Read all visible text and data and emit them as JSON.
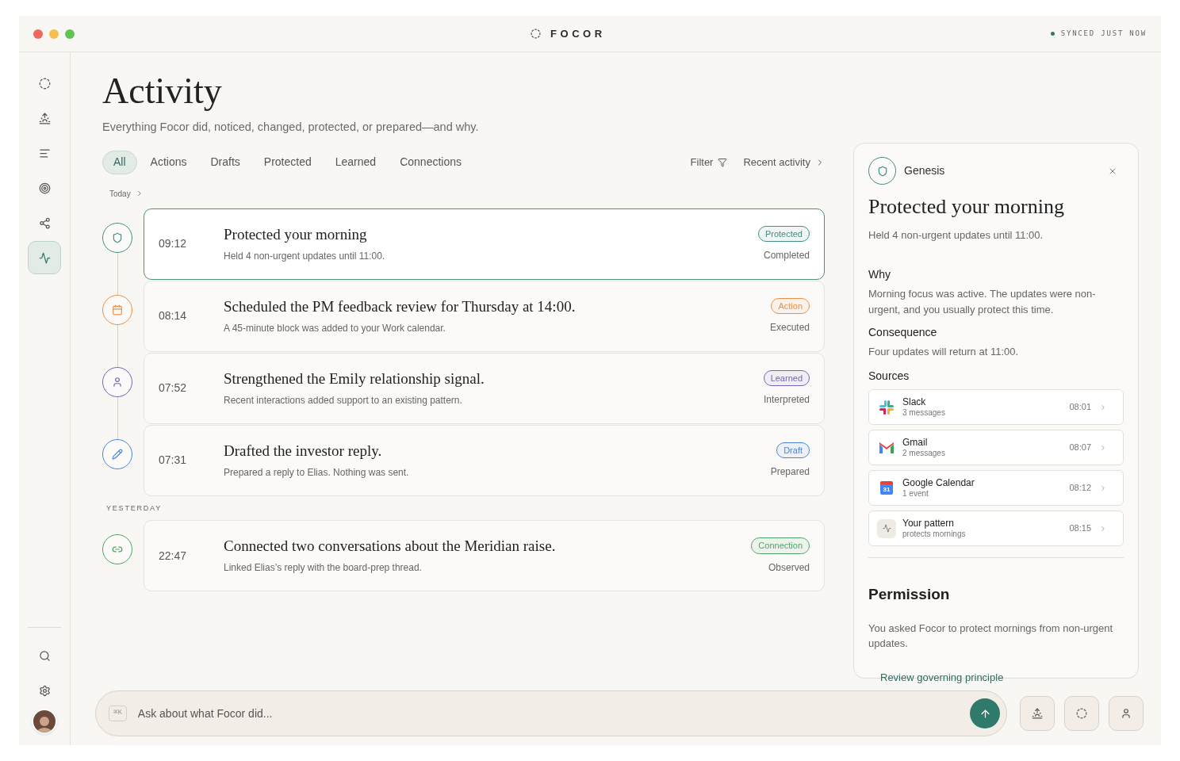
{
  "window": {
    "title": "FOCOR",
    "sync_status": "SYNCED JUST NOW"
  },
  "sidebar": {
    "items": [
      {
        "kind": "logo",
        "selected": false
      },
      {
        "kind": "sunrise",
        "selected": false
      },
      {
        "kind": "list",
        "selected": false
      },
      {
        "kind": "target",
        "selected": false
      },
      {
        "kind": "share",
        "selected": false
      },
      {
        "kind": "activity",
        "selected": true
      }
    ],
    "bottom_items": [
      {
        "kind": "search"
      },
      {
        "kind": "settings"
      }
    ]
  },
  "page": {
    "title": "Activity",
    "subtitle": "Everything Focor did, noticed, changed, protected, or prepared—and why."
  },
  "tabs": [
    {
      "label": "All",
      "selected": true
    },
    {
      "label": "Actions",
      "selected": false
    },
    {
      "label": "Drafts",
      "selected": false
    },
    {
      "label": "Protected",
      "selected": false
    },
    {
      "label": "Learned",
      "selected": false
    },
    {
      "label": "Connections",
      "selected": false
    }
  ],
  "filter": {
    "label": "Filter"
  },
  "sort": {
    "label": "Recent activity"
  },
  "groups": [
    {
      "label": "Today",
      "kind": "link",
      "items": [
        {
          "kind": "protected",
          "color": "#3f8f80",
          "time": "09:12",
          "title": "Protected your morning",
          "description": "Held 4 non-urgent updates until 11:00.",
          "tag": "Protected",
          "status": "Completed",
          "selected": true
        },
        {
          "kind": "action",
          "color": "#e8914a",
          "time": "08:14",
          "title": "Scheduled the PM feedback review for Thursday at 14:00.",
          "description": "A 45-minute block was added to your Work calendar.",
          "tag": "Action",
          "status": "Executed",
          "selected": false
        },
        {
          "kind": "learned",
          "color": "#7a62b8",
          "time": "07:52",
          "title": "Strengthened the Emily relationship signal.",
          "description": "Recent interactions added support to an existing pattern.",
          "tag": "Learned",
          "status": "Interpreted",
          "selected": false
        },
        {
          "kind": "draft",
          "color": "#4a86d9",
          "time": "07:31",
          "title": "Drafted the investor reply.",
          "description": "Prepared a reply to Elias. Nothing was sent.",
          "tag": "Draft",
          "status": "Prepared",
          "selected": false
        }
      ]
    },
    {
      "label": "YESTERDAY",
      "kind": "caps",
      "items": [
        {
          "kind": "connection",
          "color": "#4fa36a",
          "time": "22:47",
          "title": "Connected two conversations about the Meridian raise.",
          "description": "Linked Elias’s reply with the board-prep thread.",
          "tag": "Connection",
          "status": "Observed",
          "selected": false
        }
      ]
    }
  ],
  "detail": {
    "source": "Genesis",
    "title": "Protected your morning",
    "summary": "Held 4 non-urgent updates until 11:00.",
    "sections": [
      {
        "heading": "Why",
        "text": "Morning focus was active. The updates were non-urgent, and you usually protect this time."
      },
      {
        "heading": "Consequence",
        "text": "Four updates will return at 11:00."
      }
    ],
    "sources_heading": "Sources",
    "sources": [
      {
        "kind": "slack",
        "name": "Slack",
        "detail": "3 messages",
        "time": "08:01"
      },
      {
        "kind": "gmail",
        "name": "Gmail",
        "detail": "2 messages",
        "time": "08:07"
      },
      {
        "kind": "calendar",
        "name": "Google Calendar",
        "detail": "1 event",
        "time": "08:12",
        "icon_text": "31"
      },
      {
        "kind": "pattern",
        "name": "Your pattern",
        "detail": "protects mornings",
        "time": "08:15"
      }
    ],
    "permission": {
      "heading": "Permission",
      "text": "You asked Focor to protect mornings from non-urgent updates.",
      "link": "Review governing principle"
    }
  },
  "composer": {
    "shortcut": "⌘K",
    "placeholder": "Ask about what Focor did..."
  },
  "quick_actions": [
    {
      "kind": "sunrise"
    },
    {
      "kind": "logo"
    },
    {
      "kind": "person"
    }
  ]
}
